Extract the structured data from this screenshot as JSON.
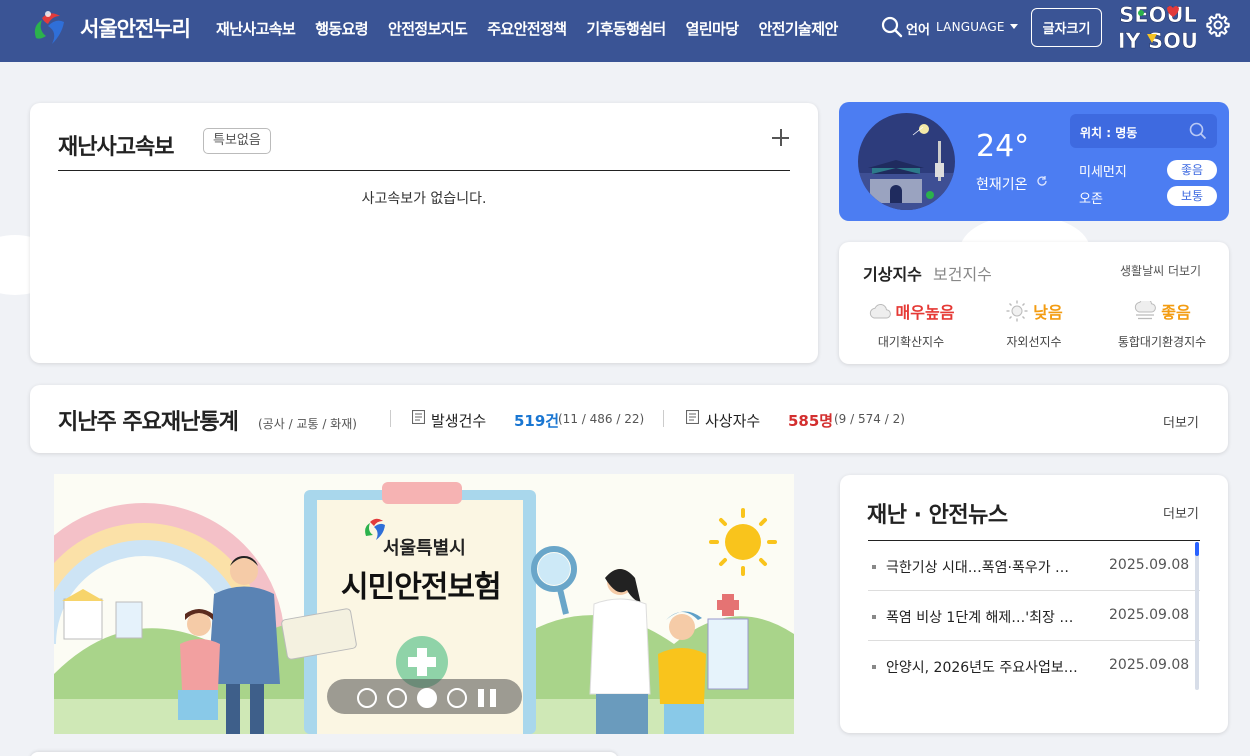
{
  "header": {
    "site_title": "서울안전누리",
    "nav": [
      "재난사고속보",
      "행동요령",
      "안전정보지도",
      "주요안전정책",
      "기후동행쉼터",
      "열린마당",
      "안전기술제안"
    ],
    "lang_label": "언어",
    "lang_en": "LANGUAGE",
    "font_button": "글자크기",
    "seoul_logo_top": "SEOUL",
    "seoul_logo_bottom": "MY SOUL"
  },
  "disaster": {
    "title": "재난사고속보",
    "badge": "특보없음",
    "empty_message": "사고속보가 없습니다."
  },
  "weather": {
    "temperature": "24°",
    "current_label": "현재기온",
    "location_label": "위치 : 명동",
    "rows": [
      {
        "label": "미세먼지",
        "status": "좋음"
      },
      {
        "label": "오존",
        "status": "보통"
      }
    ]
  },
  "indices": {
    "tab_active": "기상지수",
    "tab_inactive": "보건지수",
    "more": "생활날씨 더보기",
    "items": [
      {
        "value": "매우높음",
        "label": "대기확산지수",
        "color": "#e53935",
        "icon": "cloud-icon"
      },
      {
        "value": "낮음",
        "label": "자외선지수",
        "color": "#f39c12",
        "icon": "sun-icon"
      },
      {
        "value": "좋음",
        "label": "통합대기환경지수",
        "color": "#f39c12",
        "icon": "haze-icon"
      }
    ]
  },
  "stats": {
    "title": "지난주 주요재난통계",
    "subtitle": "(공사 / 교통 / 화재)",
    "occurrence_label": "발생건수",
    "occurrence_value": "519건",
    "occurrence_detail": "(11 / 486 / 22)",
    "casualty_label": "사상자수",
    "casualty_value": "585명",
    "casualty_detail": "(9 / 574 / 2)",
    "more": "더보기"
  },
  "banner": {
    "org": "서울특별시",
    "title": "시민안전보험",
    "active_slide": 3,
    "total_slides": 4
  },
  "news": {
    "title": "재난 · 안전뉴스",
    "more": "더보기",
    "items": [
      {
        "text": "극한기상 시대…폭염·폭우가 …",
        "date": "2025.09.08"
      },
      {
        "text": "폭염 비상 1단계 해제…'최장 …",
        "date": "2025.09.08"
      },
      {
        "text": "안양시, 2026년도 주요사업보…",
        "date": "2025.09.08"
      }
    ]
  },
  "colors": {
    "header_bg": "#3a5495",
    "weather_bg": "#4c7df2",
    "blue_value": "#1976d2",
    "red_value": "#d32f2f"
  }
}
